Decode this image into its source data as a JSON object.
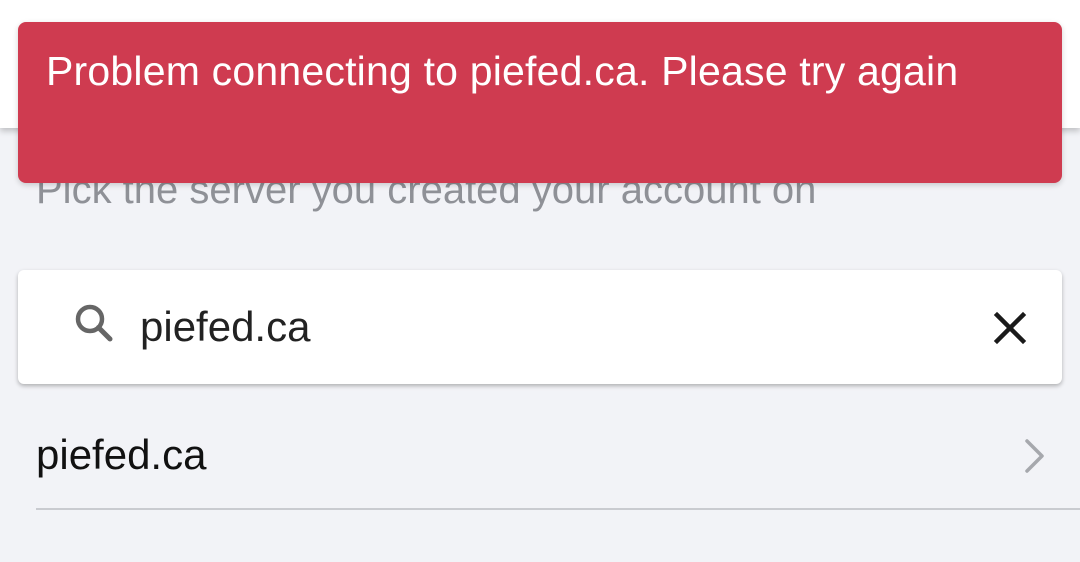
{
  "toast": {
    "message": "Problem connecting to piefed.ca. Please try again"
  },
  "header": {
    "subtitle": "Pick the server you created your account on"
  },
  "search": {
    "value": "piefed.ca",
    "icon": "search-icon",
    "clear_icon": "close-icon"
  },
  "results": {
    "items": [
      {
        "label": "piefed.ca",
        "icon": "chevron-right-icon"
      }
    ]
  },
  "colors": {
    "toast_background": "#cf3b50",
    "page_background": "#f2f3f7",
    "subtitle_text": "#8f9197"
  }
}
